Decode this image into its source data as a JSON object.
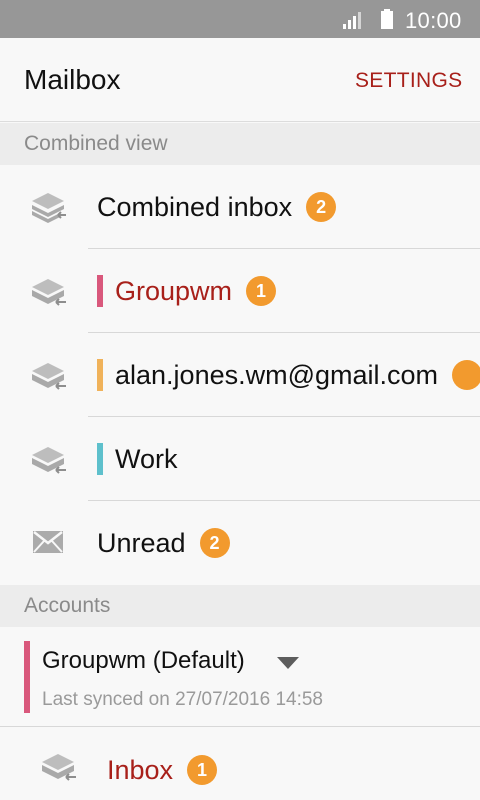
{
  "status_bar": {
    "time": "10:00"
  },
  "app_bar": {
    "title": "Mailbox",
    "settings_label": "SETTINGS"
  },
  "sections": {
    "combined_view": "Combined view",
    "accounts": "Accounts"
  },
  "combined_items": [
    {
      "label": "Combined inbox",
      "badge": "2",
      "icon": "mail-stack-icon"
    },
    {
      "label": "Groupwm",
      "badge": "1",
      "icon": "mail-stack-icon",
      "color": "#d9587c"
    },
    {
      "label": "alan.jones.wm@gmail.com",
      "badge": "",
      "icon": "mail-stack-icon",
      "color": "#f0b25a"
    },
    {
      "label": "Work",
      "icon": "mail-stack-icon",
      "color": "#5ec0cc"
    },
    {
      "label": "Unread",
      "badge": "2",
      "icon": "envelope-icon"
    }
  ],
  "account": {
    "name": "Groupwm (Default)",
    "last_synced": "Last synced on 27/07/2016 14:58",
    "color": "#d9587c",
    "inbox_label": "Inbox",
    "inbox_badge": "1"
  },
  "colors": {
    "accent_red": "#a8201a",
    "badge_orange": "#f29a2e"
  }
}
